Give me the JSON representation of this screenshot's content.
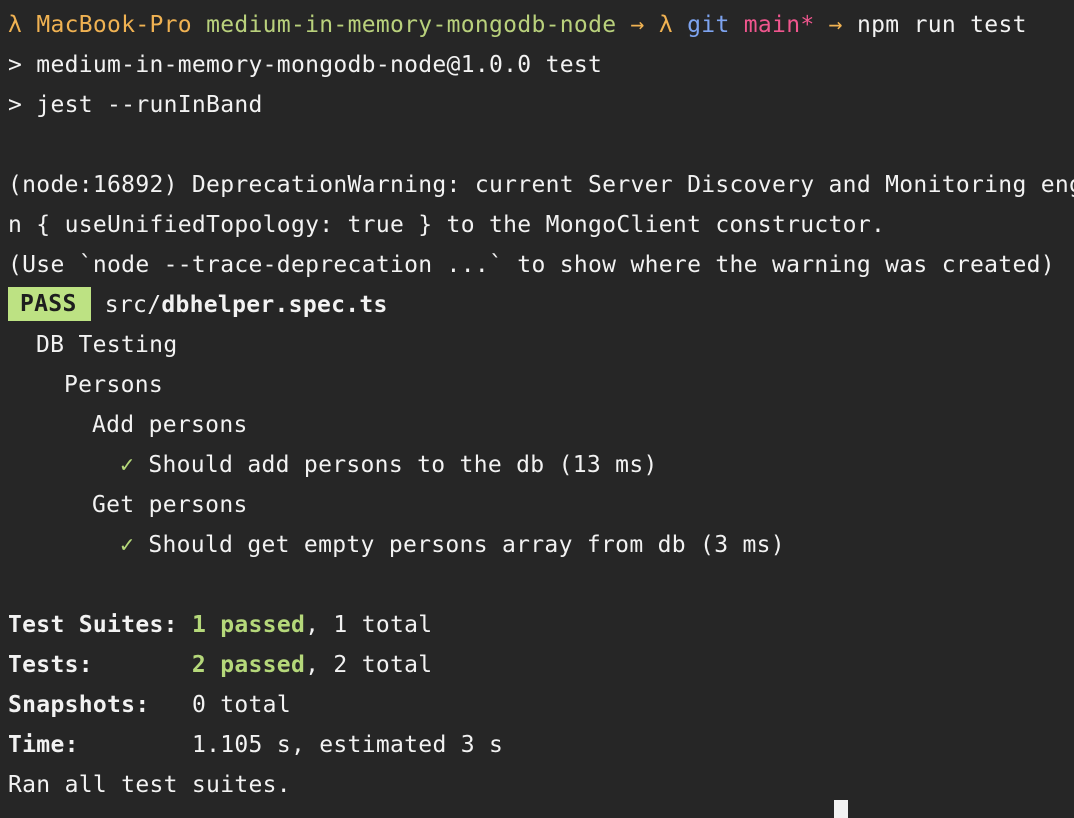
{
  "prompt": {
    "lambda": "λ",
    "host": "MacBook-Pro",
    "dir": "medium-in-memory-mongodb-node",
    "arrow": "→",
    "git": "git",
    "branch": "main*",
    "command": "npm run test"
  },
  "npm_header": {
    "line1": "> medium-in-memory-mongodb-node@1.0.0 test",
    "line2": "> jest --runInBand"
  },
  "warning": {
    "line1": "(node:16892) DeprecationWarning: current Server Discovery and Monitoring eng",
    "line2": "n { useUnifiedTopology: true } to the MongoClient constructor.",
    "line3": "(Use `node --trace-deprecation ...` to show where the warning was created)"
  },
  "result": {
    "badge": "PASS",
    "path_prefix": "src/",
    "file": "dbhelper.spec.ts"
  },
  "tests": {
    "suite": "DB Testing",
    "group": "Persons",
    "add_describe": "Add persons",
    "check": "✓",
    "add_test": "Should add persons to the db (13 ms)",
    "get_describe": "Get persons",
    "get_test": "Should get empty persons array from db (3 ms)"
  },
  "summary": {
    "suites_label": "Test Suites:",
    "suites_passed": "1 passed",
    "suites_total": ", 1 total",
    "tests_label": "Tests:",
    "tests_passed": "2 passed",
    "tests_total": ", 2 total",
    "snapshots_label": "Snapshots:",
    "snapshots_value": "0 total",
    "time_label": "Time:",
    "time_value": "1.105 s, estimated 3 s",
    "ran": "Ran all test suites."
  },
  "colors": {
    "background": "#262626",
    "prompt_orange": "#f0b252",
    "prompt_lime": "#b9d17c",
    "git_blue": "#7ea4f0",
    "branch_pink": "#f0568e",
    "pass_green": "#bde283"
  }
}
